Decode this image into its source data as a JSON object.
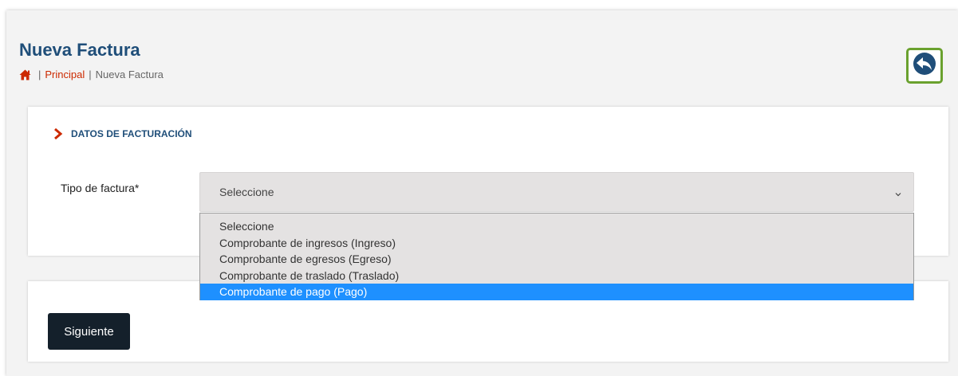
{
  "header": {
    "title": "Nueva Factura",
    "breadcrumb": {
      "home_icon": "home-icon",
      "separator": "|",
      "link": "Principal",
      "current": "Nueva Factura"
    },
    "back_icon": "reply-arrow-icon"
  },
  "section": {
    "title": "DATOS DE FACTURACIÓN",
    "chevron_icon": "chevron-right-icon",
    "field_label": "Tipo de factura*",
    "select_value": "Seleccione",
    "options": [
      "Seleccione",
      "Comprobante de ingresos (Ingreso)",
      "Comprobante de egresos (Egreso)",
      "Comprobante de traslado (Traslado)",
      "Comprobante de pago (Pago)"
    ],
    "highlighted_option": "Comprobante de pago (Pago)"
  },
  "actions": {
    "next_label": "Siguiente"
  },
  "colors": {
    "title": "#1f4e79",
    "link": "#cc2a00",
    "back_border": "#6aa12e",
    "highlight": "#1e90ff",
    "button": "#14202b"
  }
}
